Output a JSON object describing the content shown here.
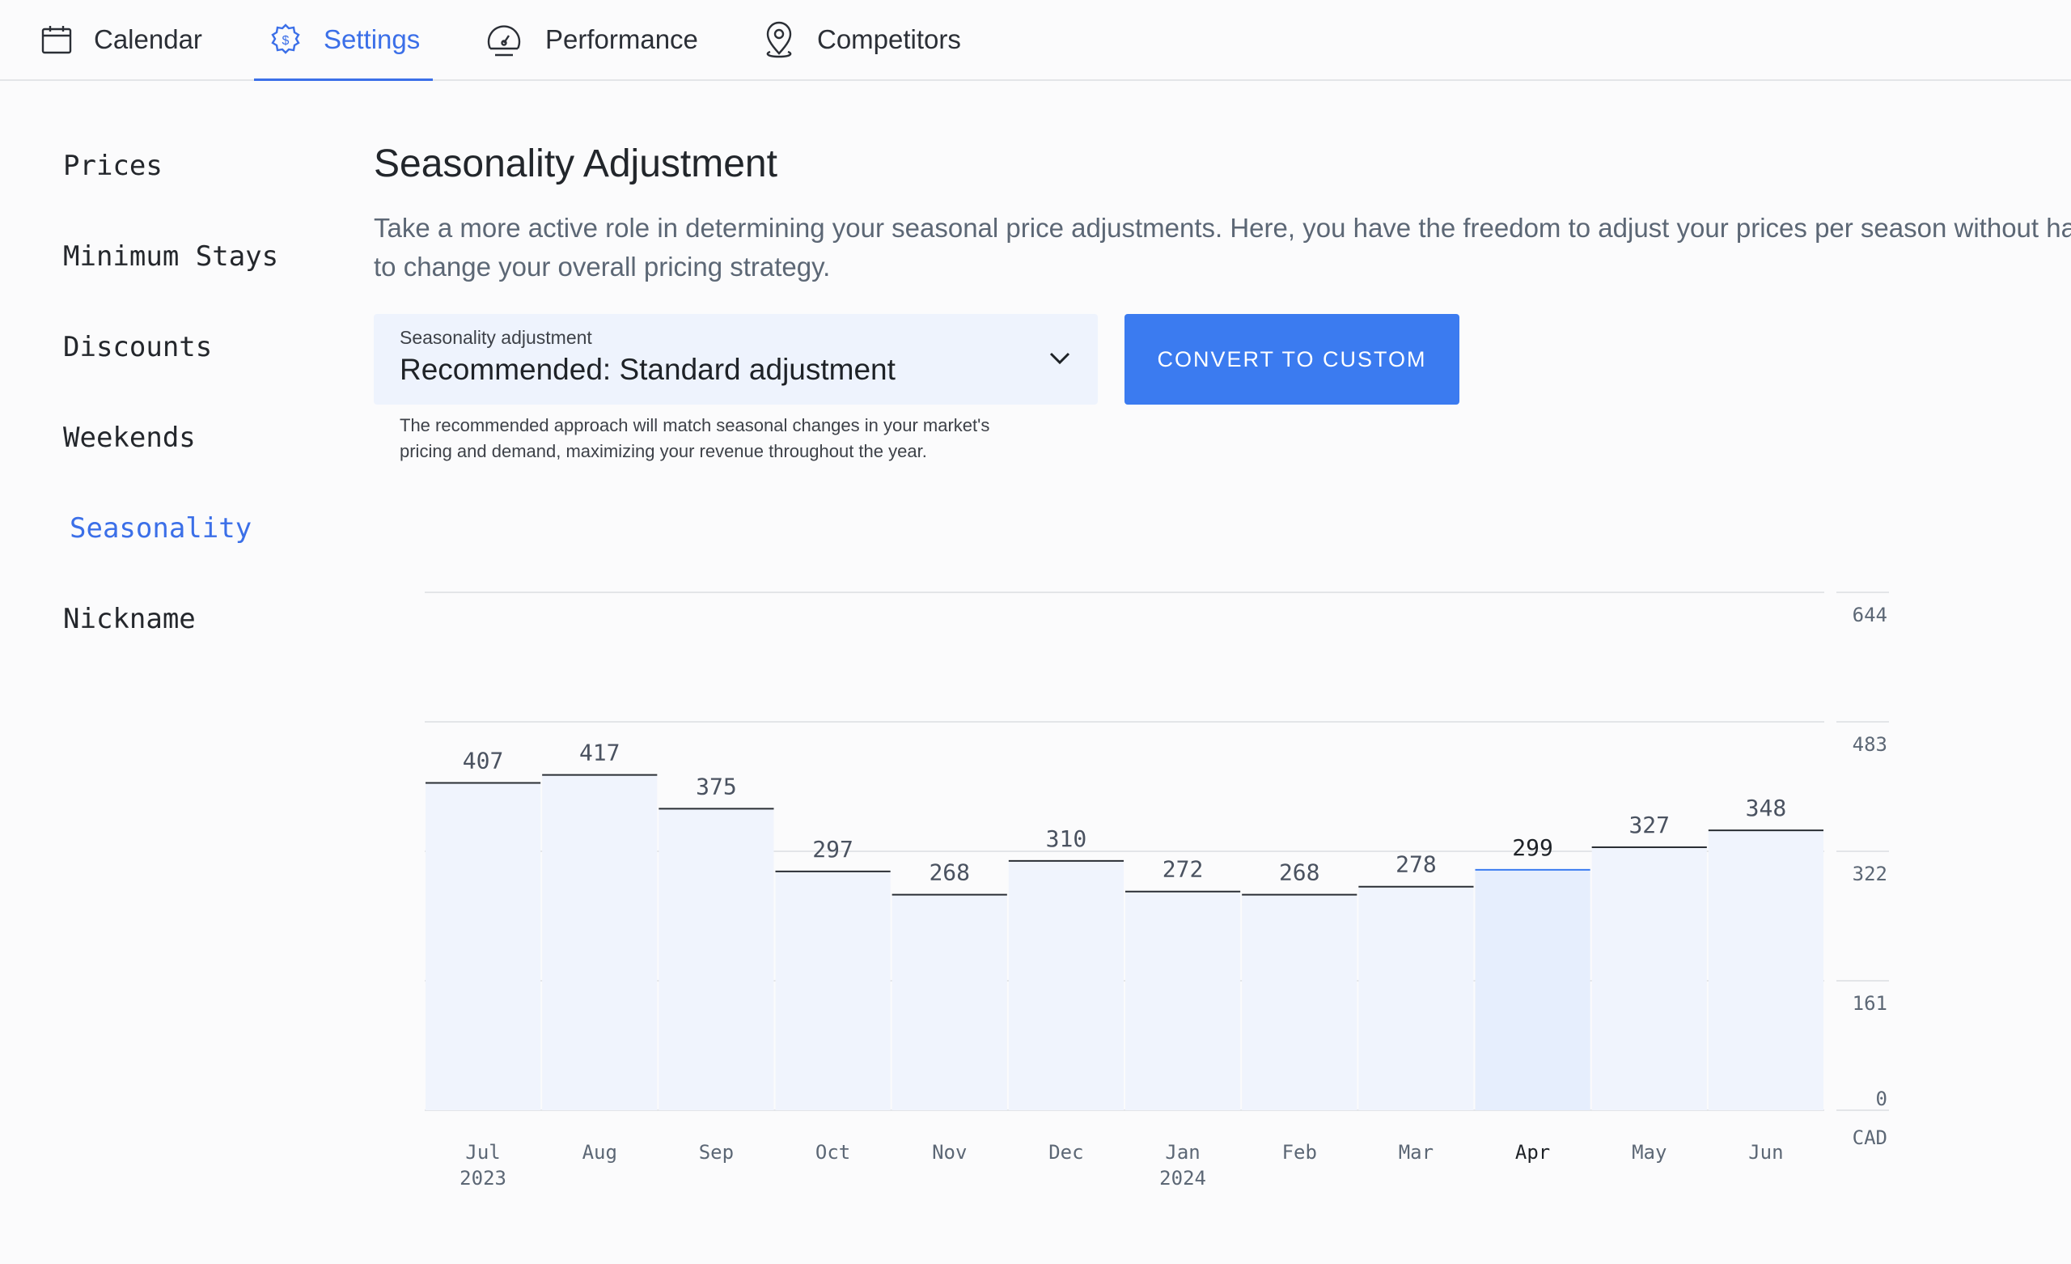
{
  "tabs": [
    {
      "label": "Calendar",
      "icon": "calendar-icon",
      "active": false
    },
    {
      "label": "Settings",
      "icon": "gear-dollar-icon",
      "active": true
    },
    {
      "label": "Performance",
      "icon": "speedometer-icon",
      "active": false
    },
    {
      "label": "Competitors",
      "icon": "map-pin-icon",
      "active": false
    }
  ],
  "sidebar": {
    "items": [
      {
        "label": "Prices",
        "active": false
      },
      {
        "label": "Minimum Stays",
        "active": false
      },
      {
        "label": "Discounts",
        "active": false
      },
      {
        "label": "Weekends",
        "active": false
      },
      {
        "label": "Seasonality",
        "active": true
      },
      {
        "label": "Nickname",
        "active": false
      }
    ]
  },
  "main": {
    "title": "Seasonality Adjustment",
    "description": "Take a more active role in determining your seasonal price adjustments. Here, you have the freedom to adjust your prices per season without having to change your overall pricing strategy.",
    "select": {
      "label": "Seasonality adjustment",
      "value": "Recommended: Standard adjustment",
      "helper": "The recommended approach will match seasonal changes in your market's pricing and demand, maximizing your revenue throughout the year."
    },
    "convert_button": "CONVERT TO CUSTOM"
  },
  "colors": {
    "accent": "#3b6fe8",
    "button": "#3b7bf0",
    "bar_fill": "#f0f4fd",
    "bar_fill_active": "#e6eefd",
    "grid": "#e3e5e8"
  },
  "chart_data": {
    "type": "bar",
    "categories": [
      "Jul",
      "Aug",
      "Sep",
      "Oct",
      "Nov",
      "Dec",
      "Jan",
      "Feb",
      "Mar",
      "Apr",
      "May",
      "Jun"
    ],
    "category_years": [
      "2023",
      "",
      "",
      "",
      "",
      "",
      "2024",
      "",
      "",
      "",
      "",
      ""
    ],
    "values": [
      407,
      417,
      375,
      297,
      268,
      310,
      272,
      268,
      278,
      299,
      327,
      348
    ],
    "highlighted_category": "Apr",
    "y_ticks": [
      0,
      161,
      322,
      483,
      644
    ],
    "ylim": [
      0,
      644
    ],
    "y_axis_position": "right",
    "unit": "CAD",
    "grid": true
  }
}
